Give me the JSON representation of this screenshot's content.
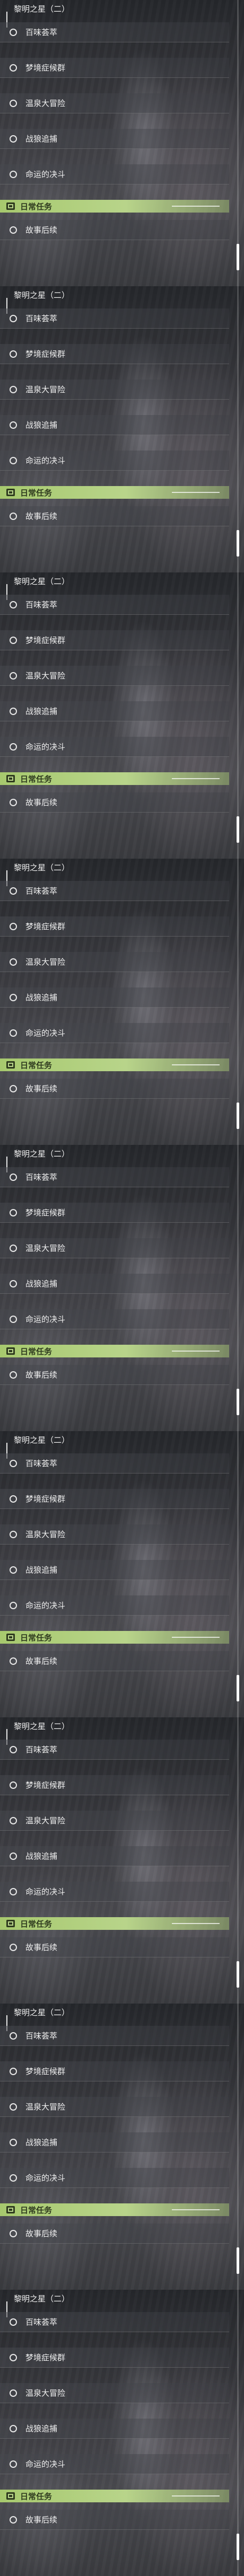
{
  "panels": [
    {
      "header": "黎明之星（二）",
      "tasks": [
        "百味荟萃",
        "梦境症候群",
        "温泉大冒险",
        "战狼追捕",
        "命运的决斗"
      ],
      "daily_label": "日常任务",
      "followup": "故事后续"
    },
    {
      "header": "黎明之星（二）",
      "tasks": [
        "百味荟萃",
        "梦境症候群",
        "温泉大冒险",
        "战狼追捕",
        "命运的决斗"
      ],
      "daily_label": "日常任务",
      "followup": "故事后续"
    },
    {
      "header": "黎明之星（二）",
      "tasks": [
        "百味荟萃",
        "梦境症候群",
        "温泉大冒险",
        "战狼追捕",
        "命运的决斗"
      ],
      "daily_label": "日常任务",
      "followup": "故事后续"
    },
    {
      "header": "黎明之星（二）",
      "tasks": [
        "百味荟萃",
        "梦境症候群",
        "温泉大冒险",
        "战狼追捕",
        "命运的决斗"
      ],
      "daily_label": "日常任务",
      "followup": "故事后续"
    },
    {
      "header": "黎明之星（二）",
      "tasks": [
        "百味荟萃",
        "梦境症候群",
        "温泉大冒险",
        "战狼追捕",
        "命运的决斗"
      ],
      "daily_label": "日常任务",
      "followup": "故事后续"
    },
    {
      "header": "黎明之星（二）",
      "tasks": [
        "百味荟萃",
        "梦境症候群",
        "温泉大冒险",
        "战狼追捕",
        "命运的决斗"
      ],
      "daily_label": "日常任务",
      "followup": "故事后续"
    },
    {
      "header": "黎明之星（二）",
      "tasks": [
        "百味荟萃",
        "梦境症候群",
        "温泉大冒险",
        "战狼追捕",
        "命运的决斗"
      ],
      "daily_label": "日常任务",
      "followup": "故事后续"
    },
    {
      "header": "黎明之星（二）",
      "tasks": [
        "百味荟萃",
        "梦境症候群",
        "温泉大冒险",
        "战狼追捕",
        "命运的决斗"
      ],
      "daily_label": "日常任务",
      "followup": "故事后续"
    },
    {
      "header": "黎明之星（二）",
      "tasks": [
        "百味荟萃",
        "梦境症候群",
        "温泉大冒险",
        "战狼追捕",
        "命运的决斗"
      ],
      "daily_label": "日常任务",
      "followup": "故事后续"
    }
  ],
  "colors": {
    "daily_accent": "#b8d48a",
    "text": "#f0f0f0"
  },
  "icons": {
    "task_marker": "circle-icon",
    "daily_marker": "daily-task-icon"
  }
}
